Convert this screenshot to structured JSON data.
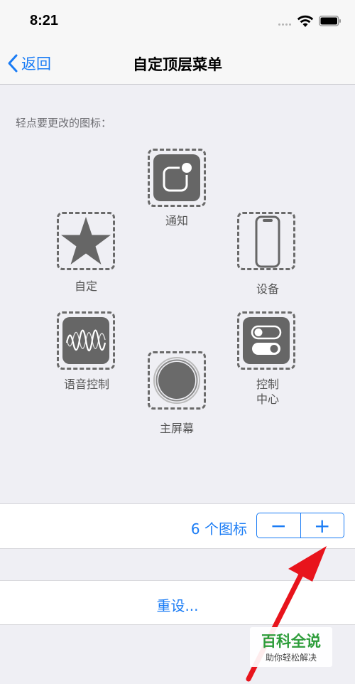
{
  "status": {
    "time": "8:21"
  },
  "nav": {
    "back_label": "返回",
    "title": "自定顶层菜单"
  },
  "instruction": "轻点要更改的图标：",
  "icons": {
    "notifications": "通知",
    "custom": "自定",
    "device": "设备",
    "voice_control": "语音控制",
    "control_center": "控制\n中心",
    "home": "主屏幕"
  },
  "stepper": {
    "count_text": "6 个图标",
    "minus": "−",
    "plus": "+"
  },
  "reset_label": "重设...",
  "watermark": {
    "title": "百科全说",
    "subtitle": "助你轻松解决"
  },
  "colors": {
    "accent": "#1a7cf5",
    "icon_tile": "#666666",
    "arrow": "#e8141c",
    "watermark_green": "#2d9d3a"
  }
}
